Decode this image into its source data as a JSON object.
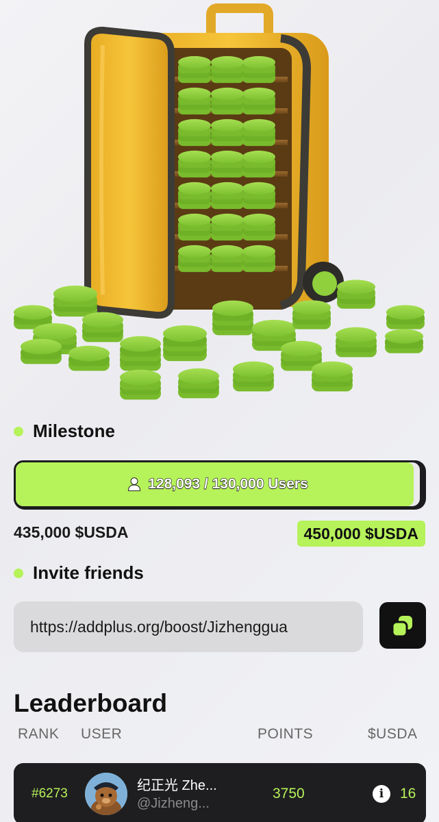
{
  "hero": {
    "image_name": "suitcase-full-of-green-coins-illustration"
  },
  "milestone": {
    "heading": "Milestone",
    "progress_text": "128,093 / 130,000 Users",
    "progress_fraction": 0.985,
    "current_reward": "435,000 $USDA",
    "next_reward": "450,000 $USDA"
  },
  "invite": {
    "heading": "Invite friends",
    "link": "https://addplus.org/boost/Jizhenggua"
  },
  "leaderboard": {
    "title": "Leaderboard",
    "columns": [
      "RANK",
      "USER",
      "POINTS",
      "$USDA"
    ],
    "rows": [
      {
        "rank": "#6273",
        "name": "纪正光 Zhe...",
        "handle": "@Jizheng...",
        "points": "3750",
        "usda": "16",
        "info_icon": "info-icon"
      }
    ]
  },
  "colors": {
    "accent": "#b6f25a",
    "dark": "#1e1e20",
    "field": "#dadadc"
  }
}
